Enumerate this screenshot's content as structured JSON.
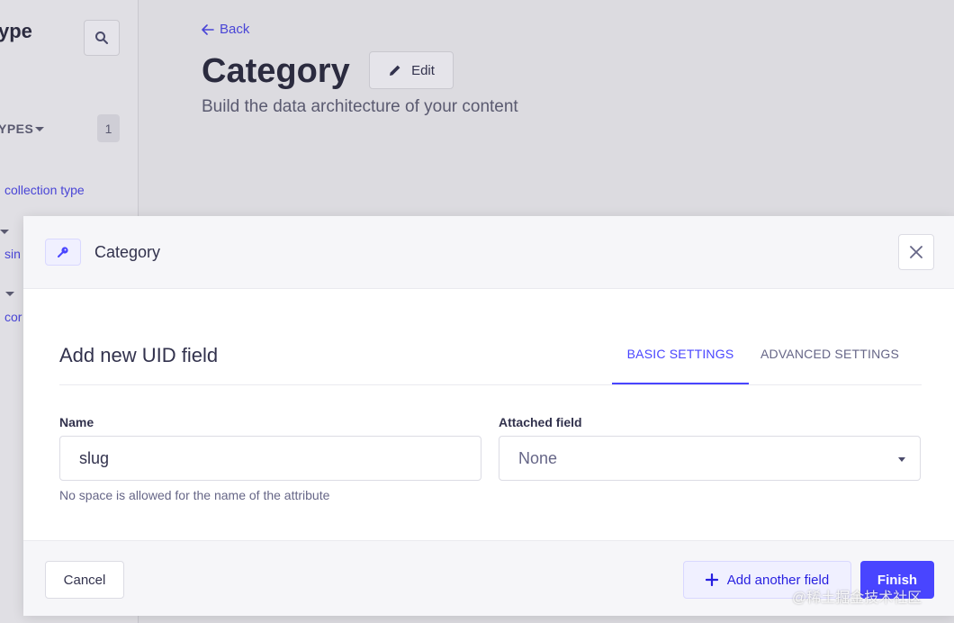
{
  "sidebar": {
    "title": "ype",
    "section_label": "YPES",
    "section_count": "1",
    "link_collection": "collection type",
    "link_single": "sin",
    "link_components": "cor"
  },
  "header": {
    "back_label": "Back",
    "title": "Category",
    "edit_label": "Edit",
    "subtitle": "Build the data architecture of your content"
  },
  "modal": {
    "title": "Category",
    "form_title": "Add new UID field",
    "tabs": [
      {
        "label": "BASIC SETTINGS",
        "active": true
      },
      {
        "label": "ADVANCED SETTINGS",
        "active": false
      }
    ],
    "name_label": "Name",
    "name_value": "slug",
    "name_hint": "No space is allowed for the name of the attribute",
    "attached_label": "Attached field",
    "attached_value": "None",
    "cancel_label": "Cancel",
    "add_label": "Add another field",
    "finish_label": "Finish"
  },
  "watermark": "@稀土掘金技术社区",
  "colors": {
    "primary": "#4945ff",
    "text": "#32324d",
    "muted": "#666687"
  }
}
